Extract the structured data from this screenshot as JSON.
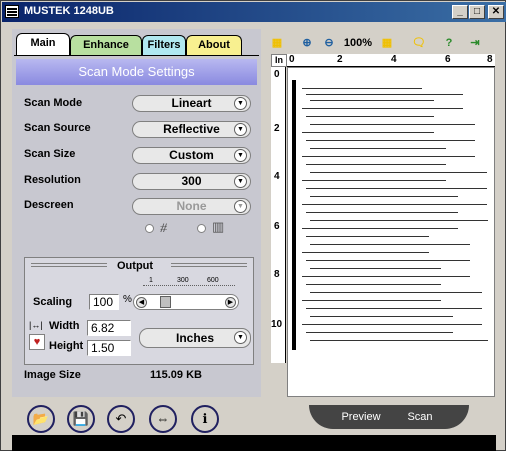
{
  "window": {
    "title": "MUSTEK 1248UB"
  },
  "tabs": [
    {
      "label": "Main"
    },
    {
      "label": "Enhance"
    },
    {
      "label": "Filters"
    },
    {
      "label": "About"
    }
  ],
  "section_title": "Scan Mode Settings",
  "settings": {
    "scan_mode": {
      "label": "Scan Mode",
      "value": "Lineart"
    },
    "scan_source": {
      "label": "Scan Source",
      "value": "Reflective"
    },
    "scan_size": {
      "label": "Scan Size",
      "value": "Custom"
    },
    "resolution": {
      "label": "Resolution",
      "value": "300"
    },
    "descreen": {
      "label": "Descreen",
      "value": "None"
    }
  },
  "output": {
    "title": "Output",
    "scaling_label": "Scaling",
    "scaling_value": "100",
    "percent": "%",
    "tick_1": "1",
    "tick_300": "300",
    "tick_600": "600",
    "width_label": "Width",
    "width_value": "6.82",
    "height_label": "Height",
    "height_value": "1.50",
    "units": "Inches"
  },
  "image_size": {
    "label": "Image Size",
    "value": "115.09 KB"
  },
  "toolbar": {
    "zoom": "100%"
  },
  "ruler": {
    "unit": "In",
    "top": [
      "0",
      "2",
      "4",
      "6",
      "8"
    ],
    "left": [
      "0",
      "2",
      "4",
      "6",
      "8",
      "10"
    ]
  },
  "preview_button": "Preview",
  "scan_button": "Scan"
}
